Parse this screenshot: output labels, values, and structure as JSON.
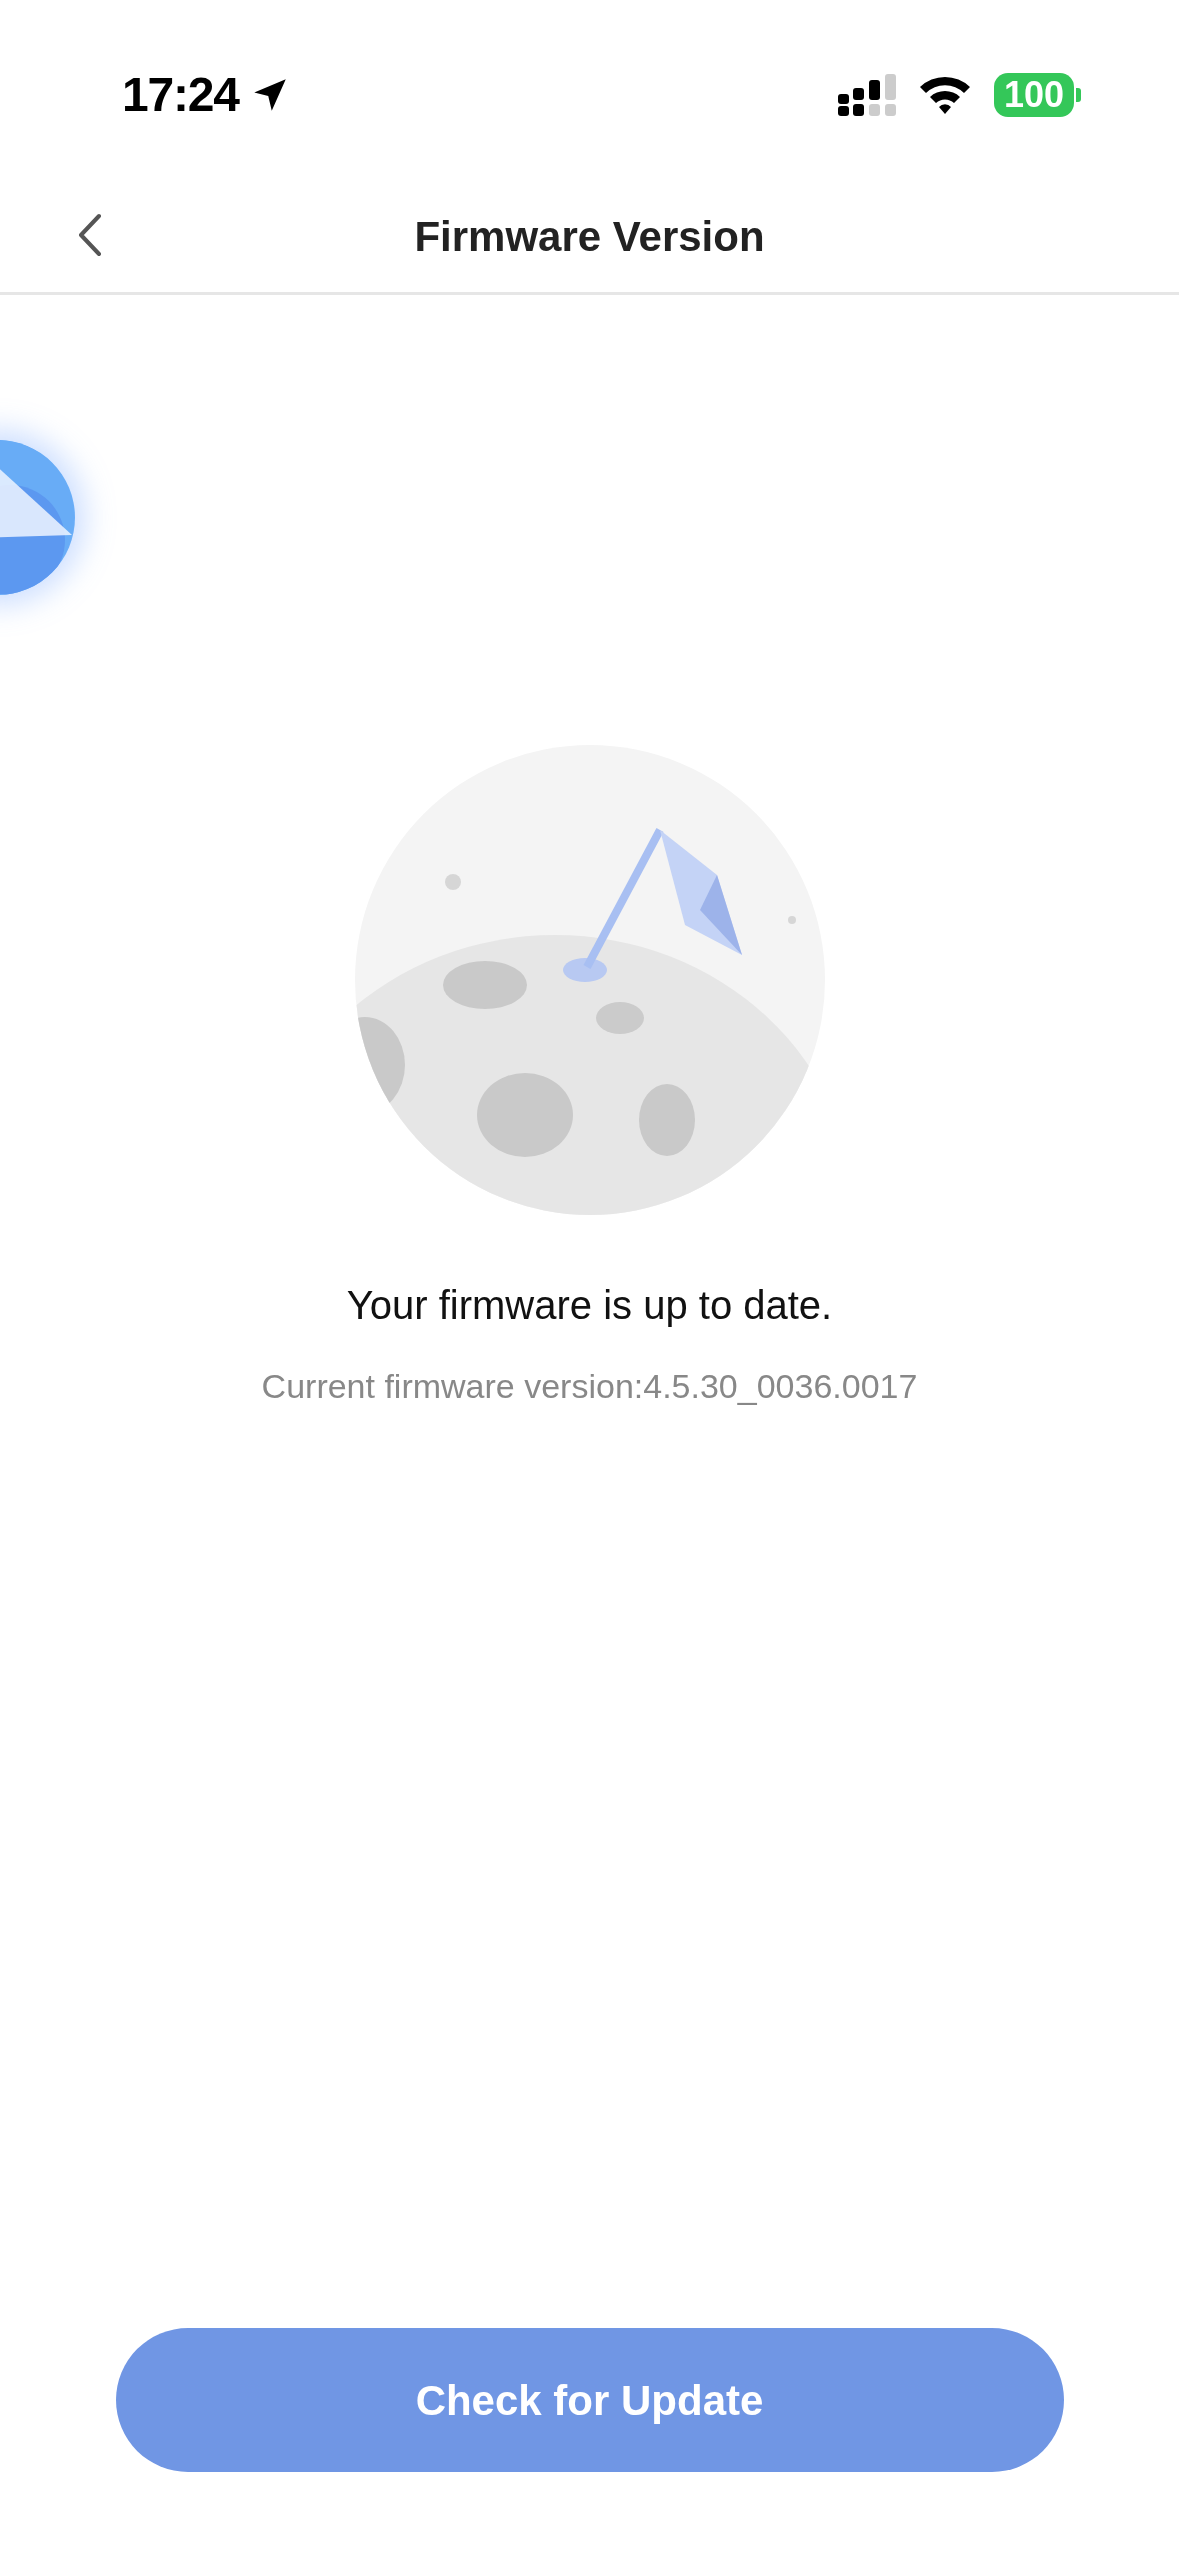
{
  "status_bar": {
    "time": "17:24",
    "battery": "100"
  },
  "nav": {
    "title": "Firmware Version"
  },
  "message": {
    "heading": "Your firmware is up to date.",
    "version": "Current firmware version:4.5.30_0036.0017"
  },
  "button": {
    "label": "Check for Update"
  }
}
